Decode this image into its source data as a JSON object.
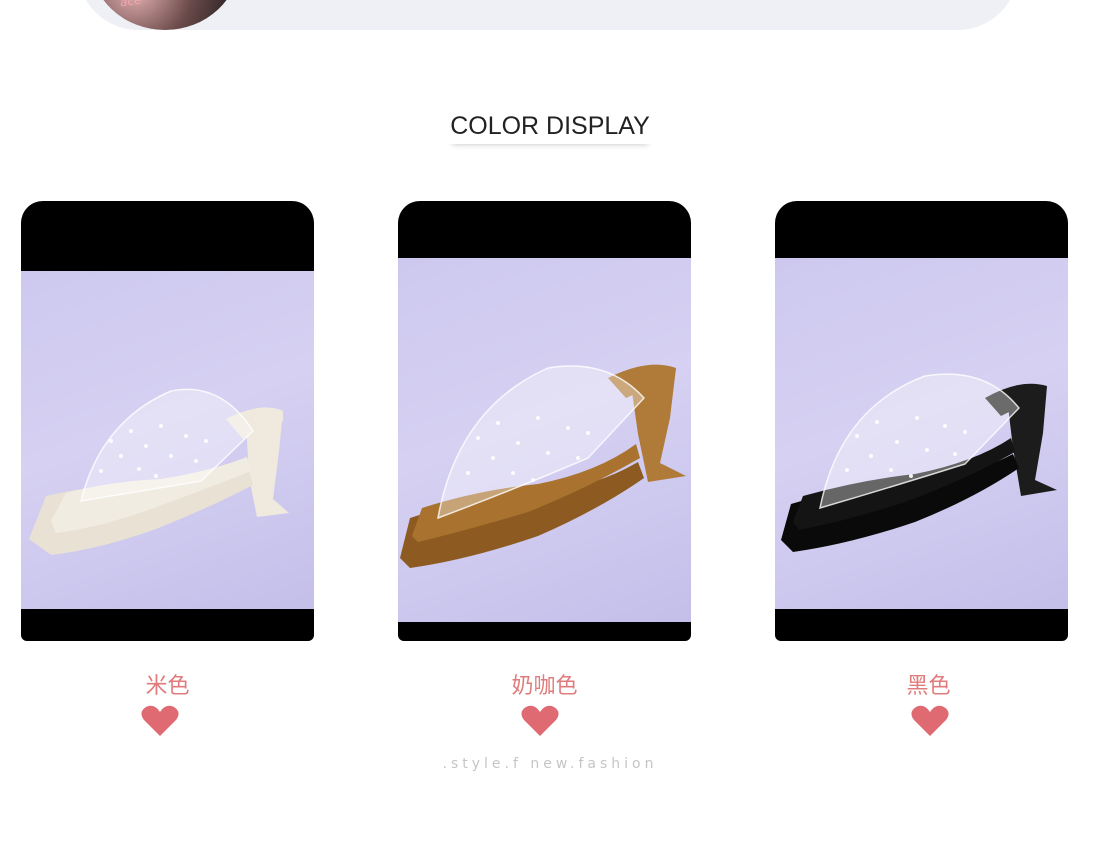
{
  "section": {
    "title": "COLOR DISPLAY",
    "tagline": ".style.f new.fashion"
  },
  "products": [
    {
      "label": "米色",
      "shoe_color": "#f1ece2",
      "sole_color": "#e8e1d4",
      "heel_color": "#efe9de"
    },
    {
      "label": "奶咖色",
      "shoe_color": "#a9732f",
      "sole_color": "#8d5b22",
      "heel_color": "#b07a38"
    },
    {
      "label": "黑色",
      "shoe_color": "#141414",
      "sole_color": "#0a0a0a",
      "heel_color": "#1c1c1c"
    }
  ],
  "colors": {
    "accent": "#e07c7c",
    "heart": "#df6a72",
    "title": "#222222"
  },
  "icons": {
    "heart": "heart-icon"
  }
}
